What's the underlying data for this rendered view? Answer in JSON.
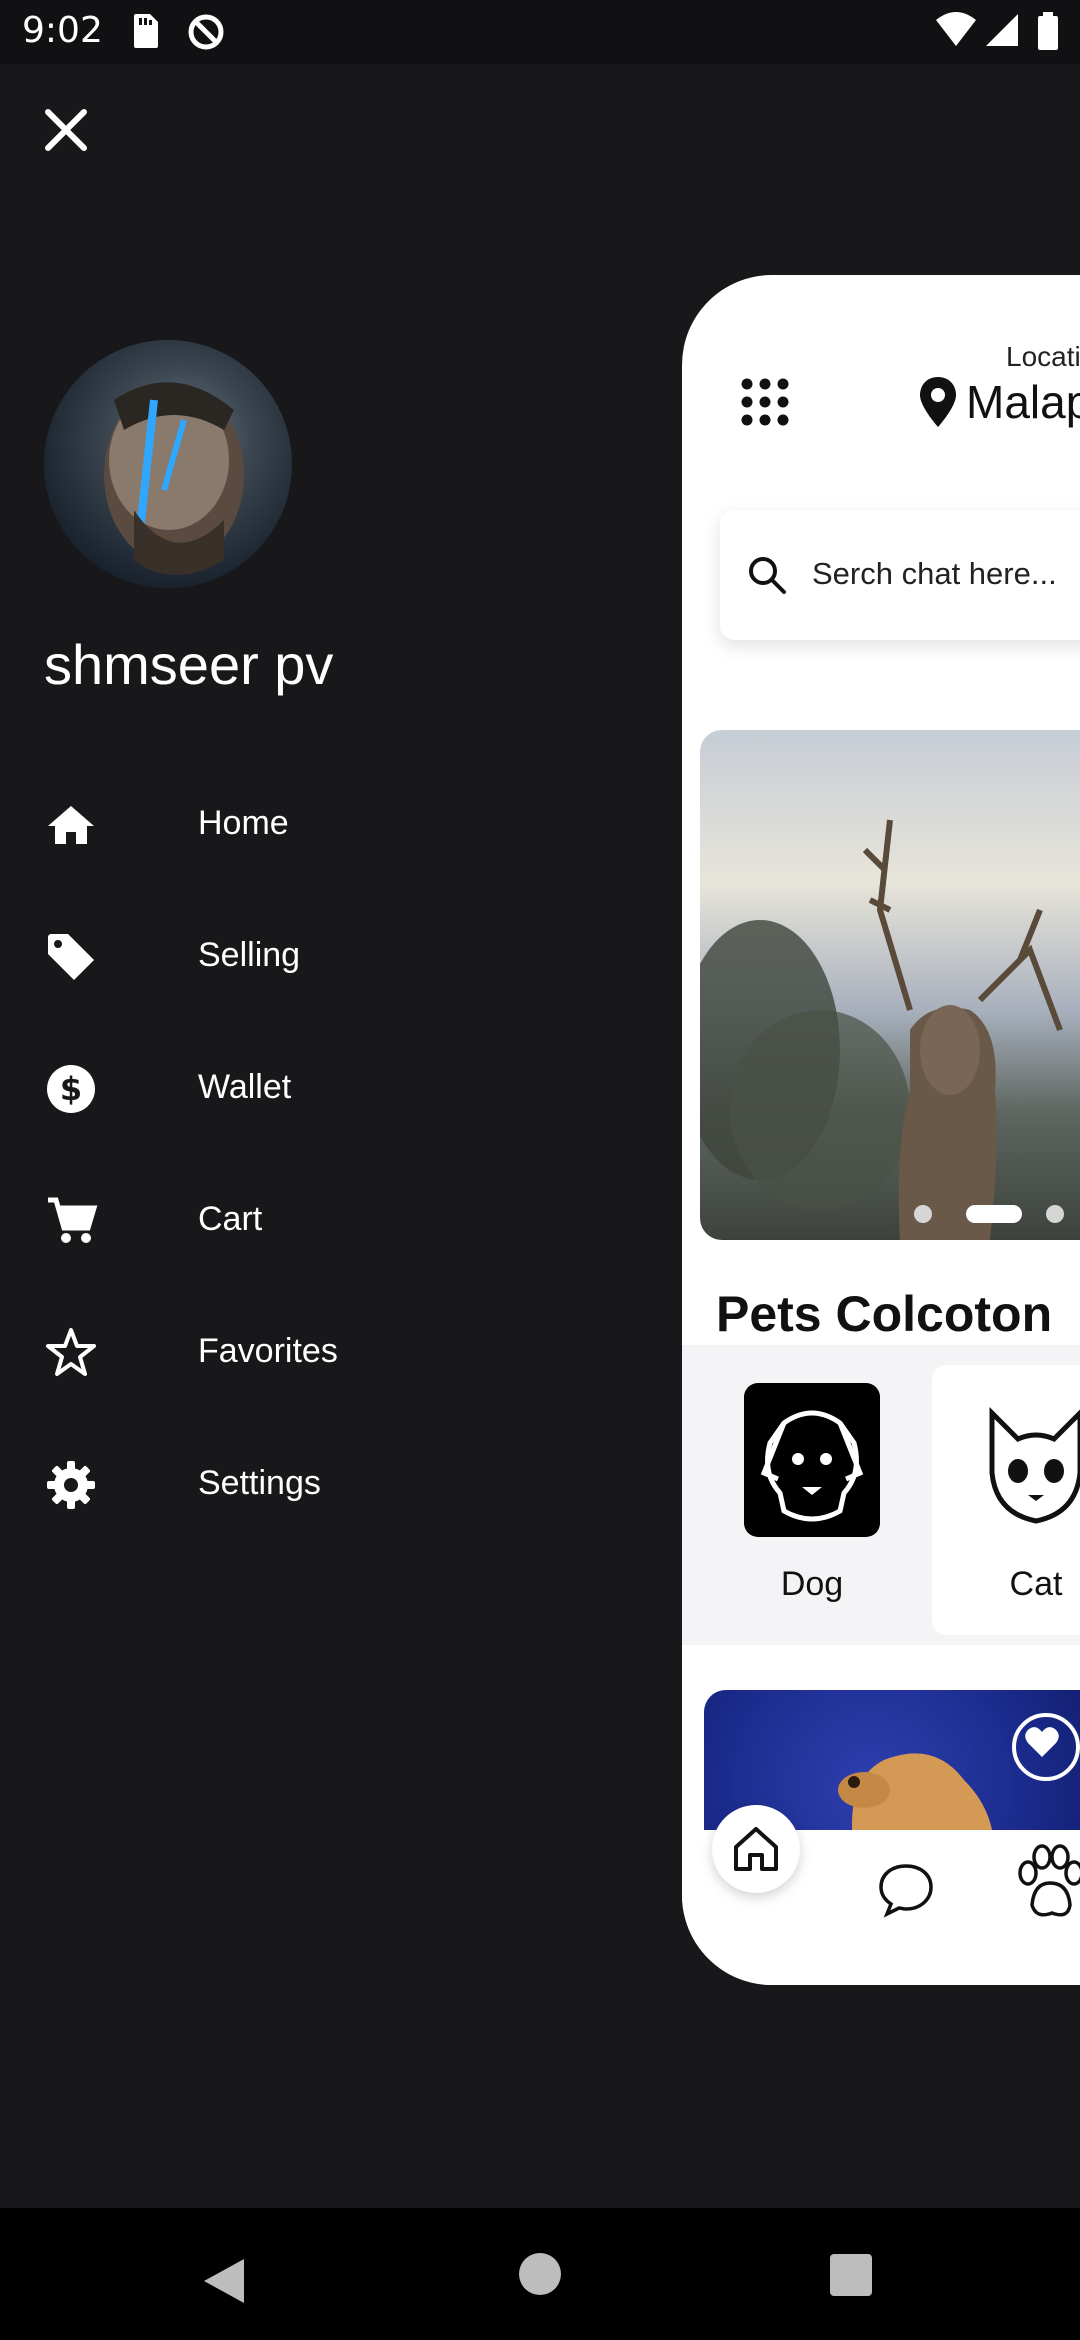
{
  "status_bar": {
    "time": "9:02"
  },
  "drawer": {
    "user_name": "shmseer pv",
    "menu": [
      {
        "label": "Home",
        "icon": "home-icon"
      },
      {
        "label": "Selling",
        "icon": "tag-icon"
      },
      {
        "label": "Wallet",
        "icon": "dollar-icon"
      },
      {
        "label": "Cart",
        "icon": "cart-icon"
      },
      {
        "label": "Favorites",
        "icon": "star-icon"
      },
      {
        "label": "Settings",
        "icon": "gear-icon"
      }
    ]
  },
  "preview": {
    "location_label": "Locati",
    "location_value": "Malap",
    "search_placeholder": "Serch chat here...",
    "section_title": "Pets Colcoton",
    "categories": [
      {
        "label": "Dog",
        "icon": "dog-icon"
      },
      {
        "label": "Cat",
        "icon": "cat-icon"
      }
    ]
  },
  "colors": {
    "drawer_bg": "#18181b",
    "panel_bg": "#ffffff",
    "accent_blue": "#1a2a8a"
  }
}
